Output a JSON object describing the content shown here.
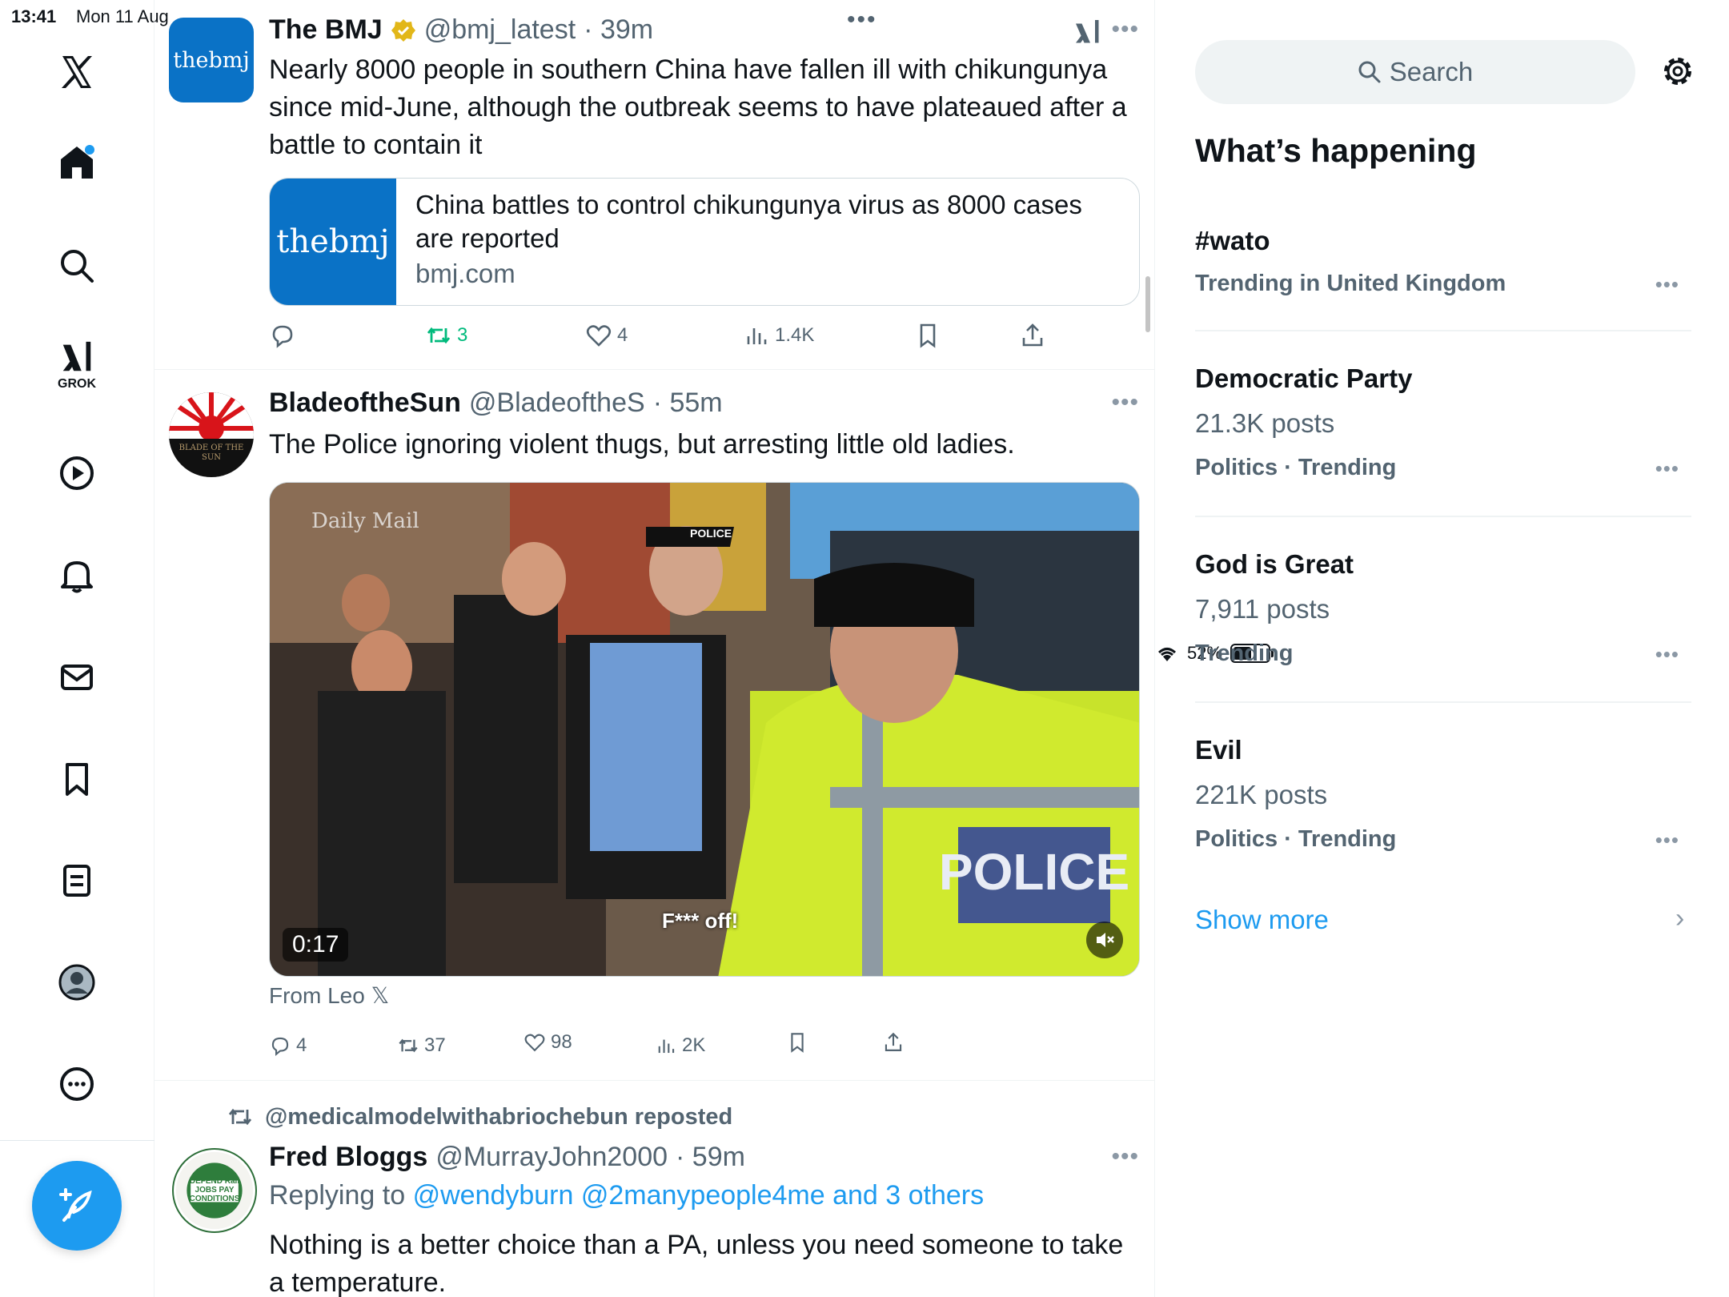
{
  "status_bar": {
    "time": "13:41",
    "date": "Mon 11 Aug",
    "battery": "52%",
    "battery_level": 0.52
  },
  "left_nav": {
    "items": [
      "x-logo",
      "home",
      "explore",
      "grok",
      "video",
      "notifications",
      "messages",
      "bookmarks",
      "lists",
      "profile",
      "more"
    ],
    "grok_label": "GROK",
    "home_has_notification": true
  },
  "feed": {
    "top_dots": "•••",
    "tweets": [
      {
        "avatar_text": "thebmj",
        "name": "The BMJ",
        "verified": true,
        "handle": "@bmj_latest",
        "time": "· 39m",
        "text": "Nearly 8000 people in southern China have fallen ill with chikungunya since mid-June, although the outbreak seems to have plateaued after a battle to contain it",
        "card": {
          "thumb_text": "thebmj",
          "title": "China battles to control chikungunya virus as 8000 cases are reported",
          "domain": "bmj.com"
        },
        "actions": {
          "replies": "",
          "reposts": "3",
          "likes": "4",
          "views": "1.4K"
        }
      },
      {
        "name": "BladeoftheSun",
        "handle": "@BladeoftheS",
        "time": "· 55m",
        "text": "The Police ignoring violent thugs, but arresting little old ladies.",
        "avatar_text": "BLADE OF THE SUN",
        "media": {
          "duration": "0:17",
          "overlay_brand": "Daily Mail",
          "caption": "F*** off!",
          "police_label": "POLICE"
        },
        "from": "From Leo",
        "actions": {
          "replies": "4",
          "reposts": "37",
          "likes": "98",
          "views": "2K"
        }
      },
      {
        "reposted_by": "@medicalmodelwithabriochebun reposted",
        "name": "Fred Bloggs",
        "handle": "@MurrayJohn2000",
        "time": "· 59m",
        "replying_prefix": "Replying to",
        "replying_to": "@wendyburn @2manypeople4me and 3 others",
        "avatar_text": "DEFEND Rail JOBS PAY CONDITIONS RMT",
        "text": "Nothing is a better choice than a PA, unless you need someone to take a temperature."
      }
    ]
  },
  "sidebar": {
    "search_placeholder": "Search",
    "section_title": "What’s happening",
    "trends": [
      {
        "name": "#wato",
        "posts": "",
        "meta": "Trending in United Kingdom"
      },
      {
        "name": "Democratic Party",
        "posts": "21.3K posts",
        "meta": "Politics · Trending"
      },
      {
        "name": "God is Great",
        "posts": "7,911 posts",
        "meta": "Trending"
      },
      {
        "name": "Evil",
        "posts": "221K posts",
        "meta": "Politics · Trending"
      }
    ],
    "show_more": "Show more"
  },
  "colors": {
    "accent": "#1d9bf0",
    "repost_active": "#00ba7c",
    "bmj_blue": "#0a72c6",
    "muted": "#536471"
  }
}
